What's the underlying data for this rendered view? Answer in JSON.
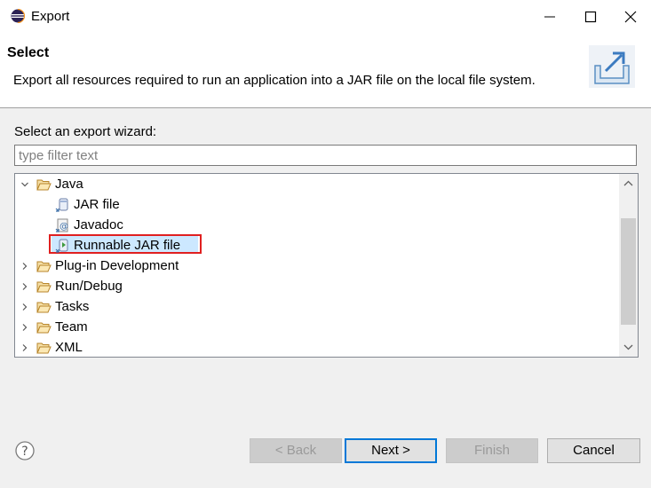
{
  "window": {
    "title": "Export",
    "icon": "eclipse-icon",
    "controls": [
      "minimize-icon",
      "maximize-icon",
      "close-icon"
    ]
  },
  "header": {
    "title": "Select",
    "description": "Export all resources required to run an application into a JAR file on the local file system.",
    "icon": "export-wizard-icon"
  },
  "filter": {
    "label": "Select an export wizard:",
    "placeholder": "type filter text",
    "value": ""
  },
  "tree": {
    "java": {
      "label": "Java",
      "expanded": true,
      "children": [
        {
          "label": "JAR file",
          "icon": "jar-file-icon"
        },
        {
          "label": "Javadoc",
          "icon": "javadoc-icon"
        },
        {
          "label": "Runnable JAR file",
          "icon": "runnable-jar-icon",
          "selected": true
        }
      ]
    },
    "categories": [
      {
        "label": "Plug-in Development"
      },
      {
        "label": "Run/Debug"
      },
      {
        "label": "Tasks"
      },
      {
        "label": "Team"
      },
      {
        "label": "XML"
      }
    ]
  },
  "buttons": {
    "back": "< Back",
    "next": "Next >",
    "finish": "Finish",
    "cancel": "Cancel"
  },
  "colors": {
    "selection": "#cce8ff",
    "highlight_border": "#e02020",
    "default_button_border": "#0078d7"
  }
}
